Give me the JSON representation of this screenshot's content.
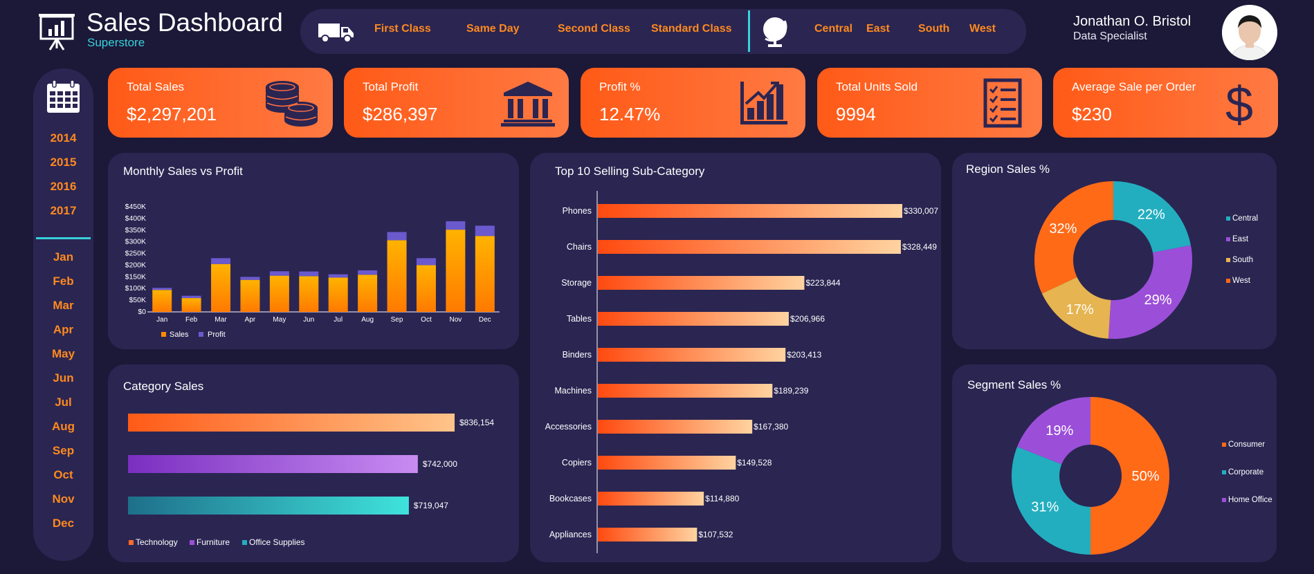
{
  "header": {
    "title": "Sales Dashboard",
    "subtitle": "Superstore",
    "ship_modes": [
      "First Class",
      "Same Day",
      "Second Class",
      "Standard Class"
    ],
    "regions": [
      "Central",
      "East",
      "South",
      "West"
    ],
    "user_name": "Jonathan O. Bristol",
    "user_role": "Data Specialist"
  },
  "sidebar": {
    "years": [
      "2014",
      "2015",
      "2016",
      "2017"
    ],
    "months": [
      "Jan",
      "Feb",
      "Mar",
      "Apr",
      "May",
      "Jun",
      "Jul",
      "Aug",
      "Sep",
      "Oct",
      "Nov",
      "Dec"
    ]
  },
  "kpis": [
    {
      "label": "Total Sales",
      "value": "$2,297,201",
      "icon": "coins-icon"
    },
    {
      "label": "Total Profit",
      "value": "$286,397",
      "icon": "bank-icon"
    },
    {
      "label": "Profit %",
      "value": "12.47%",
      "icon": "growth-chart-icon"
    },
    {
      "label": "Total Units Sold",
      "value": "9994",
      "icon": "checklist-icon"
    },
    {
      "label": "Average Sale per Order",
      "value": "$230",
      "icon": "dollar-icon"
    }
  ],
  "colors": {
    "background": "#1c1838",
    "panel": "#2b2552",
    "accent_orange": "#ff5a17",
    "accent_cyan": "#37d2dc",
    "sales": "#ff8c00",
    "profit": "#6a5acd",
    "purple": "#9b4fd8",
    "teal": "#22aebf",
    "gold": "#e6b450"
  },
  "chart_data": [
    {
      "id": "monthly",
      "type": "bar",
      "stacked": true,
      "title": "Monthly Sales vs Profit",
      "categories": [
        "Jan",
        "Feb",
        "Mar",
        "Apr",
        "May",
        "Jun",
        "Jul",
        "Aug",
        "Sep",
        "Oct",
        "Nov",
        "Dec"
      ],
      "series": [
        {
          "name": "Sales",
          "values": [
            94000,
            59000,
            205000,
            137000,
            155000,
            153000,
            147000,
            159000,
            307000,
            200000,
            352000,
            325000
          ]
        },
        {
          "name": "Profit",
          "values": [
            9000,
            10000,
            25000,
            13000,
            19000,
            20000,
            14000,
            19000,
            35000,
            30000,
            36000,
            44000
          ]
        }
      ],
      "yticks": [
        "$0",
        "$50K",
        "$100K",
        "$150K",
        "$200K",
        "$250K",
        "$300K",
        "$350K",
        "$400K",
        "$450K"
      ],
      "ylim": [
        0,
        450000
      ],
      "legend": "bottom-left"
    },
    {
      "id": "category",
      "type": "bar",
      "orientation": "horizontal",
      "title": "Category Sales",
      "categories": [
        "Technology",
        "Furniture",
        "Office Supplies"
      ],
      "values": [
        836154,
        742000,
        719047
      ],
      "labels": [
        "$836,154",
        "$742,000",
        "$719,047"
      ],
      "legend": "bottom-left"
    },
    {
      "id": "subcategory",
      "type": "bar",
      "orientation": "horizontal",
      "title": "Top 10 Selling Sub-Category",
      "categories": [
        "Phones",
        "Chairs",
        "Storage",
        "Tables",
        "Binders",
        "Machines",
        "Accessories",
        "Copiers",
        "Bookcases",
        "Appliances"
      ],
      "values": [
        330007,
        328449,
        223844,
        206966,
        203413,
        189239,
        167380,
        149528,
        114880,
        107532
      ],
      "labels": [
        "$330,007",
        "$328,449",
        "$223,844",
        "$206,966",
        "$203,413",
        "$189,239",
        "$167,380",
        "$149,528",
        "$114,880",
        "$107,532"
      ]
    },
    {
      "id": "region",
      "type": "pie",
      "donut": true,
      "title": "Region Sales %",
      "categories": [
        "Central",
        "East",
        "South",
        "West"
      ],
      "values": [
        22,
        29,
        17,
        32
      ],
      "labels": [
        "22%",
        "29%",
        "17%",
        "32%"
      ],
      "legend": "right"
    },
    {
      "id": "segment",
      "type": "pie",
      "donut": true,
      "title": "Segment Sales %",
      "categories": [
        "Consumer",
        "Corporate",
        "Home Office"
      ],
      "values": [
        50,
        31,
        19
      ],
      "labels": [
        "50%",
        "31%",
        "19%"
      ],
      "legend": "right"
    }
  ]
}
